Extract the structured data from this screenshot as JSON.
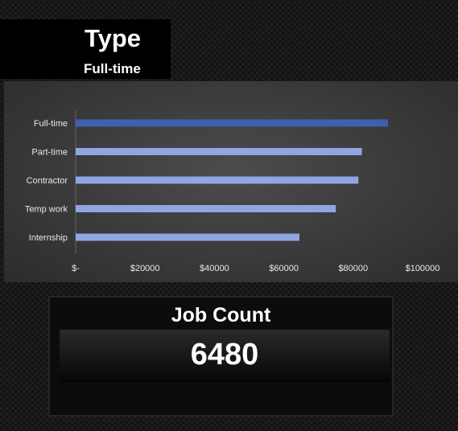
{
  "slicer": {
    "title": "Type",
    "selected": "Full-time"
  },
  "chart_data": {
    "type": "bar",
    "orientation": "horizontal",
    "categories": [
      "Full-time",
      "Part-time",
      "Contractor",
      "Temp work",
      "Internship"
    ],
    "values": [
      90000,
      82500,
      81500,
      75000,
      64500
    ],
    "xlim": [
      0,
      100000
    ],
    "x_ticks": [
      "$-",
      "$20000",
      "$40000",
      "$60000",
      "$80000",
      "$100000"
    ],
    "title": "",
    "xlabel": "",
    "ylabel": "",
    "grid": false,
    "highlighted_category": "Full-time",
    "colors": {
      "highlight": "#3f5fb0",
      "bar": "#8fa6e0"
    }
  },
  "kpi": {
    "title": "Job Count",
    "value": "6480"
  }
}
